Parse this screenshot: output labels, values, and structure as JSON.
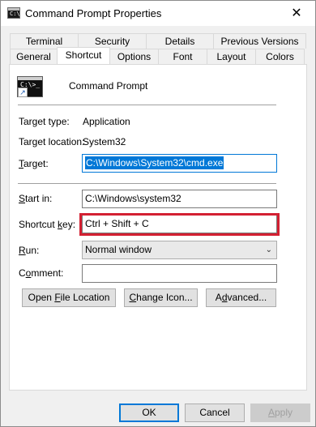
{
  "window": {
    "title": "Command Prompt Properties",
    "icon_glyph": "C:\\>_",
    "close_glyph": "✕"
  },
  "tabs": {
    "back_row": [
      "Terminal",
      "Security",
      "Details",
      "Previous Versions"
    ],
    "front_row": [
      "General",
      "Shortcut",
      "Options",
      "Font",
      "Layout",
      "Colors"
    ],
    "active": "Shortcut"
  },
  "shortcut": {
    "name": "Command Prompt",
    "icon_glyph": "C:\\>_",
    "target_type_label": "Target type:",
    "target_type_value": "Application",
    "target_location_label": "Target location:",
    "target_location_value": "System32",
    "target_label_first": "T",
    "target_label_rest": "arget:",
    "target_value": "C:\\Windows\\System32\\cmd.exe",
    "start_in_label_first": "S",
    "start_in_label_rest": "tart in:",
    "start_in_value": "C:\\Windows\\system32",
    "shortcut_key_label_pre": "Shortcut ",
    "shortcut_key_label_u": "k",
    "shortcut_key_label_post": "ey:",
    "shortcut_key_value": "Ctrl + Shift + C",
    "run_label_first": "R",
    "run_label_rest": "un:",
    "run_value": "Normal window",
    "comment_label_pre": "C",
    "comment_label_u": "o",
    "comment_label_post": "mment:",
    "comment_value": ""
  },
  "buttons": {
    "open_file_location": {
      "pre": "Open ",
      "u": "F",
      "post": "ile Location"
    },
    "change_icon": {
      "pre": "",
      "u": "C",
      "post": "hange Icon..."
    },
    "advanced": {
      "pre": "A",
      "u": "d",
      "post": "vanced..."
    },
    "ok": "OK",
    "cancel": "Cancel",
    "apply": {
      "pre": "",
      "u": "A",
      "post": "pply"
    }
  },
  "colors": {
    "accent": "#0078d7",
    "highlight": "#d32032"
  }
}
